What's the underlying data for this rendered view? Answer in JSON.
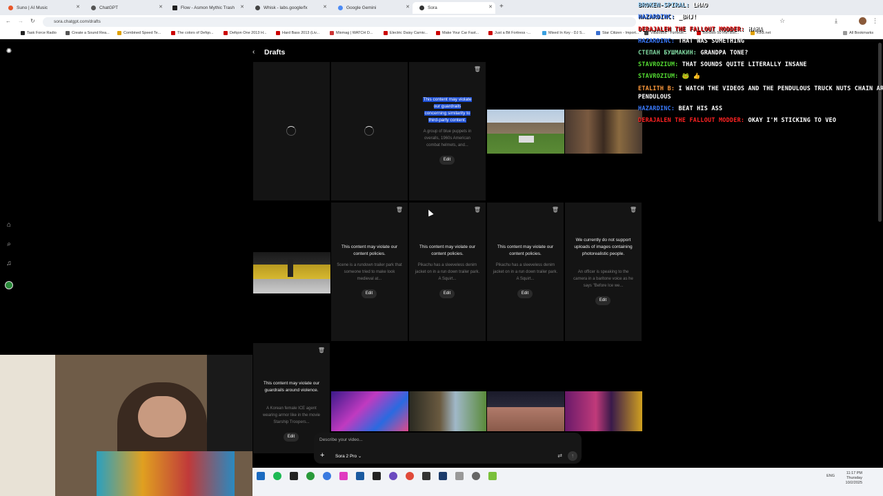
{
  "browser": {
    "tabs": [
      {
        "label": "Suno | AI Music",
        "color": "#e8572a"
      },
      {
        "label": "ChatGPT",
        "color": "#555"
      },
      {
        "label": "Flow - Asmon Mythic Trash",
        "color": "#222"
      },
      {
        "label": "Whisk - labs.google/fx",
        "color": "#444"
      },
      {
        "label": "Google Gemini",
        "color": "#4c8bf5"
      },
      {
        "label": "Sora",
        "color": "#333"
      }
    ],
    "url": "sora.chatgpt.com/drafts",
    "bookmarks": [
      "Task Force Radio",
      "Create a Sound Rea...",
      "Combined Speed Te...",
      "The colors of Defqo...",
      "Defqon One 2013 H...",
      "Hard Bass 2013 (Liv...",
      "Mixmag | WATCH D...",
      "Electric Daisy Carniv...",
      "Make Your Car Fast...",
      "Just a Bit Fortress -...",
      "Mixed In Key - DJ S...",
      "Star Citizen - Import...",
      "Villalobos - Fizheue...",
      "Bonobo 50 min Boil...",
      "Kirtz.net"
    ],
    "all_bookmarks": "All Bookmarks"
  },
  "page": {
    "title": "Drafts",
    "back": "‹"
  },
  "cards": {
    "c3_msg": "This content may violate our guardrails concerning similarity to third-party content.",
    "c3_sub": "A group of blue puppets in overalls, 1960s American combat helmets, and...",
    "edit": "Edit",
    "c7_msg": "This content may violate our content policies.",
    "c7_sub": "Scene is a rundown trailer park that someone tried to make look medieval at...",
    "c8_msg": "This content may violate our content policies.",
    "c8_sub": "Pikachu has a sleeveless denim jacket on in a run down trailer park. A Squirt...",
    "c9_msg": "This content may violate our content policies.",
    "c9_sub": "Pikachu has a sleeveless denim jacket on in a run down trailer park. A Squirt...",
    "c10_msg": "We currently do not support uploads of images containing photorealistic people.",
    "c10_sub": "An officer is speaking to the camera in a baritone voice as he says \"Before Ice we...",
    "c11_msg": "This content may violate our guardrails around violence.",
    "c11_sub": "A Korean female ICE agent wearing armor like in the movie Starship Troopers..."
  },
  "composer": {
    "placeholder": "Describe your video...",
    "model": "Sora 2 Pro ⌄"
  },
  "chat": [
    {
      "user": "Broken-Spiral:",
      "msg": "LMAO",
      "color": "#9fd8ff"
    },
    {
      "user": "Hazardinc:",
      "msg": "_BMJ!",
      "color": "#3a7bff"
    },
    {
      "user": "Derajalen The Fallout Modder:",
      "msg": "HAHA",
      "color": "#ff2222"
    },
    {
      "user": "Hazardinc:",
      "msg": "that was something",
      "color": "#3a7bff"
    },
    {
      "user": "Степан Бушмакин:",
      "msg": "Grandpa tone?",
      "color": "#7fd7a0"
    },
    {
      "user": "Stavrozium:",
      "msg": "That sounds quite literally insane",
      "color": "#55dd33"
    },
    {
      "user": "Stavrozium:",
      "msg": "🐸 👍",
      "color": "#55dd33"
    },
    {
      "user": "Etalith B:",
      "msg": "I watch the videos and the pendulous truck nuts chain are ...",
      "color": "#ff9a3c"
    },
    {
      "user": "",
      "msg": "pendulous",
      "color": "#ffffff"
    },
    {
      "user": "Hazardinc:",
      "msg": "Beat his ass",
      "color": "#3a7bff"
    },
    {
      "user": "Derajalen The Fallout Modder:",
      "msg": "Okay I'm sticking to Veo",
      "color": "#ff2222"
    }
  ],
  "taskbar": {
    "lang": "ENG",
    "time": "11:17 PM",
    "day": "Thursday",
    "date": "10/2/2025"
  }
}
